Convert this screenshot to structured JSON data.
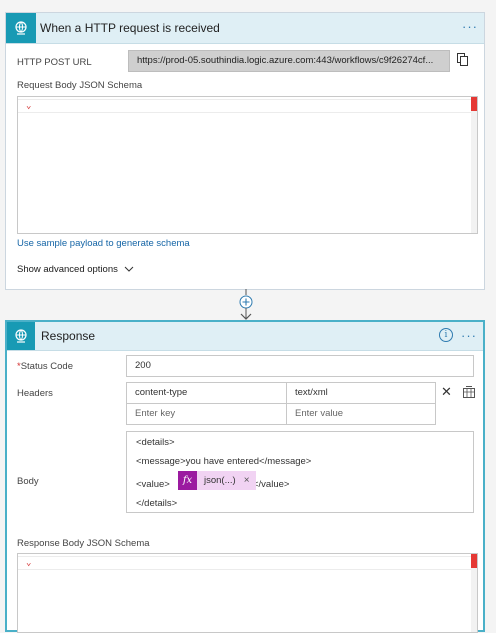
{
  "trigger": {
    "title": "When a HTTP request is received",
    "menu_glyph": "···",
    "url_label": "HTTP POST URL",
    "url_value": "https://prod-05.southindia.logic.azure.com:443/workflows/c9f26274cf...",
    "schema_label": "Request Body JSON Schema",
    "sample_link": "Use sample payload to generate schema",
    "advanced_link": "Show advanced options"
  },
  "response": {
    "title": "Response",
    "info_glyph": "i",
    "menu_glyph": "···",
    "status_required_marker": "*",
    "status_label": "Status Code",
    "status_value": "200",
    "headers_label": "Headers",
    "headers": [
      {
        "key": "content-type",
        "value": "text/xml"
      }
    ],
    "header_key_placeholder": "Enter key",
    "header_value_placeholder": "Enter value",
    "body_label": "Body",
    "body_lines": [
      "<details>",
      "<message>you have entered</message>",
      "<value>",
      "</value>",
      "</details>"
    ],
    "token_fx": "fx",
    "token_label": "json(...)",
    "token_remove": "×",
    "response_schema_label": "Response Body JSON Schema"
  },
  "colors": {
    "accent": "#189ab4",
    "header_bg": "#dfeff5",
    "link": "#1565a6",
    "token": "#9b1aa0",
    "token_bg": "#f1d3f3"
  }
}
